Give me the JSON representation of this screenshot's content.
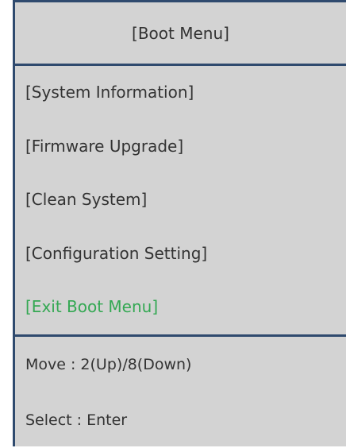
{
  "header": {
    "title": "[Boot Menu]"
  },
  "menu": {
    "items": [
      {
        "label": "[System Information]"
      },
      {
        "label": "[Firmware Upgrade]"
      },
      {
        "label": "[Clean System]"
      },
      {
        "label": "[Configuration Setting]"
      },
      {
        "label": "[Exit Boot Menu]"
      }
    ],
    "selected_index": 4
  },
  "footer": {
    "move_hint": "Move : 2(Up)/8(Down)",
    "select_hint": "Select : Enter"
  },
  "colors": {
    "panel_bg": "#d3d3d3",
    "border": "#2f4a6e",
    "text": "#333333",
    "selected_text": "#34a853"
  }
}
